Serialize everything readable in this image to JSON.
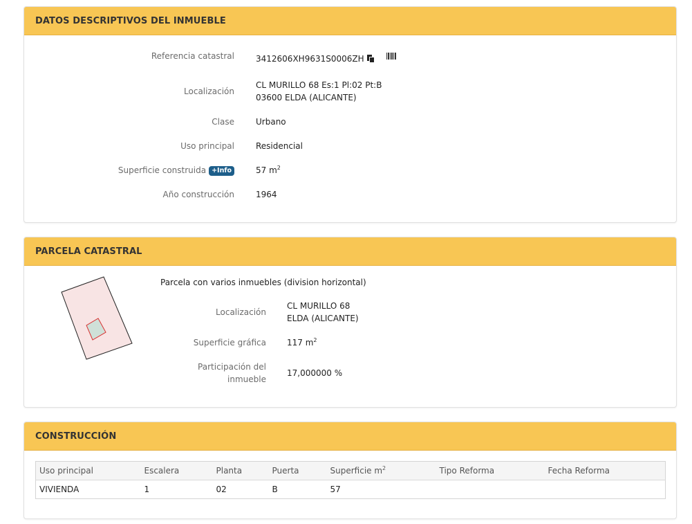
{
  "datos": {
    "header": "DATOS DESCRIPTIVOS DEL INMUEBLE",
    "referencia": {
      "label": "Referencia catastral",
      "value": "3412606XH9631S0006ZH"
    },
    "localizacion": {
      "label": "Localización",
      "line1": "CL MURILLO 68 Es:1 Pl:02 Pt:B",
      "line2": "03600 ELDA (ALICANTE)"
    },
    "clase": {
      "label": "Clase",
      "value": "Urbano"
    },
    "uso": {
      "label": "Uso principal",
      "value": "Residencial"
    },
    "superficie": {
      "label": "Superficie construida",
      "info_badge": "+Info",
      "value": "57 m",
      "unit_exp": "2"
    },
    "anio": {
      "label": "Año construcción",
      "value": "1964"
    }
  },
  "parcela": {
    "header": "PARCELA CATASTRAL",
    "description": "Parcela con varios inmuebles (division horizontal)",
    "localizacion": {
      "label": "Localización",
      "line1": "CL MURILLO 68",
      "line2": "ELDA (ALICANTE)"
    },
    "superficie": {
      "label": "Superficie gráfica",
      "value": "117 m",
      "unit_exp": "2"
    },
    "participacion": {
      "label_line1": "Participación del",
      "label_line2": "inmueble",
      "value": "17,000000 %"
    }
  },
  "construccion": {
    "header": "CONSTRUCCIÓN",
    "columns": {
      "uso": "Uso principal",
      "escalera": "Escalera",
      "planta": "Planta",
      "puerta": "Puerta",
      "superficie": "Superficie m",
      "superficie_exp": "2",
      "tipo": "Tipo Reforma",
      "fecha": "Fecha Reforma"
    },
    "rows": [
      {
        "uso": "VIVIENDA",
        "escalera": "1",
        "planta": "02",
        "puerta": "B",
        "superficie": "57",
        "tipo": "",
        "fecha": ""
      }
    ]
  },
  "icons": {
    "copy": "copy-icon",
    "barcode": "barcode-icon"
  },
  "colors": {
    "header_bg": "#f8c654",
    "info_badge": "#1d5e8a",
    "parcel_fill": "#f8e4e4",
    "building_fill": "#cfe0d8",
    "building_stroke": "#d93030"
  }
}
